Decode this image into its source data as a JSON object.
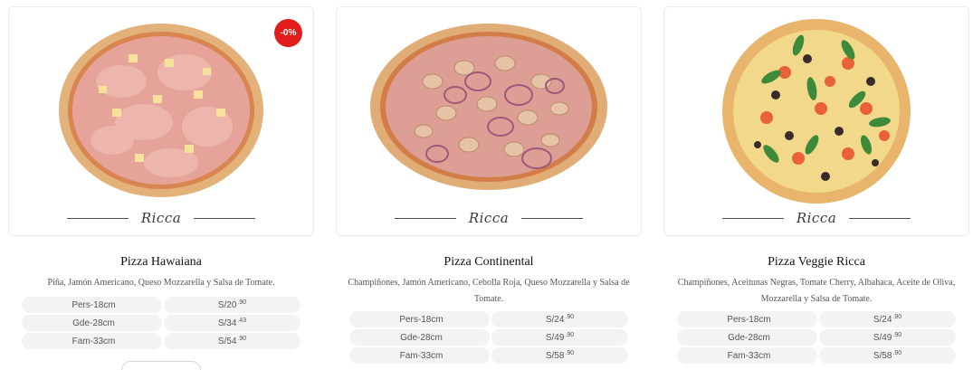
{
  "products": [
    {
      "name": "Pizza Hawaiana",
      "badge": "-0%",
      "brand": "Ricca",
      "description": "Piña, Jamón Americano, Queso Mozzarella y Salsa de Tomate.",
      "prices": [
        {
          "size": "Pers-18cm",
          "currency": "S/ ",
          "amount": "20",
          "cents": ".90"
        },
        {
          "size": "Gde-28cm",
          "currency": "S/ ",
          "amount": "34",
          "cents": ".43"
        },
        {
          "size": "Fam-33cm",
          "currency": "S/ ",
          "amount": "54",
          "cents": ".90"
        }
      ]
    },
    {
      "name": "Pizza Continental",
      "brand": "Ricca",
      "description": "Champiñones, Jamón Americano, Cebolla Roja, Queso Mozzarella y Salsa de Tomate.",
      "prices": [
        {
          "size": "Pers-18cm",
          "currency": "S/ ",
          "amount": "24",
          "cents": ".90"
        },
        {
          "size": "Gde-28cm",
          "currency": "S/ ",
          "amount": "49",
          "cents": ".90"
        },
        {
          "size": "Fam-33cm",
          "currency": "S/ ",
          "amount": "58",
          "cents": ".90"
        }
      ]
    },
    {
      "name": "Pizza Veggie Ricca",
      "brand": "Ricca",
      "description": "Champiñones, Aceitunas Negras, Tomate Cherry, Albahaca, Aceite de Oliva, Mozzarella y Salsa de Tomate.",
      "prices": [
        {
          "size": "Pers-18cm",
          "currency": "S/ ",
          "amount": "24",
          "cents": ".90"
        },
        {
          "size": "Gde-28cm",
          "currency": "S/ ",
          "amount": "49",
          "cents": ".90"
        },
        {
          "size": "Fam-33cm",
          "currency": "S/ ",
          "amount": "58",
          "cents": ".90"
        }
      ]
    }
  ],
  "colors": {
    "badge": "#e21b1b",
    "price_pill": "#f3f3f3"
  }
}
